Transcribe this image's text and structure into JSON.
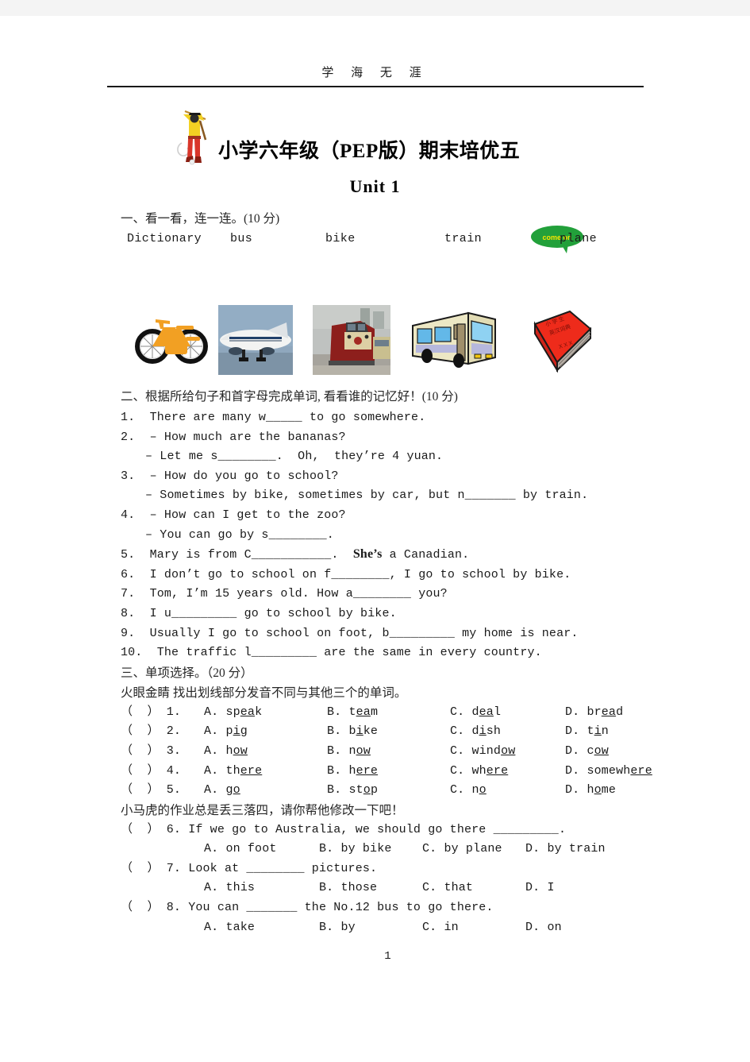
{
  "header": {
    "watermark": "学 海 无 涯"
  },
  "title": {
    "main": "小学六年级（PEP版）期末培优五",
    "main_prefix": "小学六年级（",
    "main_pep": "PEP",
    "main_suffix": "版）期末培优五",
    "badge": "come on",
    "badge_color": "#22a03a",
    "badge_text_color": "#f5e400",
    "unit": "Unit 1"
  },
  "section1": {
    "heading": "一、看一看，连一连。(10 分)",
    "words": [
      "Dictionary",
      "bus",
      "bike",
      "train",
      "plane"
    ],
    "pictures": [
      {
        "name": "bicycle-picture",
        "alt": "bike"
      },
      {
        "name": "airplane-picture",
        "alt": "plane"
      },
      {
        "name": "train-picture",
        "alt": "train"
      },
      {
        "name": "bus-picture",
        "alt": "bus"
      },
      {
        "name": "dictionary-picture",
        "alt": "Dictionary"
      }
    ]
  },
  "section2": {
    "heading": "二、根据所给句子和首字母完成单词, 看看谁的记忆好！(10 分)",
    "items": [
      {
        "no": "1.",
        "lines": [
          {
            "text": "1.  There are many w_____ to go somewhere.",
            "indent": false
          }
        ]
      },
      {
        "no": "2.",
        "lines": [
          {
            "text": "2.  – How much are the bananas?",
            "indent": false
          },
          {
            "text": "– Let me s________.  Oh,  they’re 4 yuan.",
            "indent": true
          }
        ]
      },
      {
        "no": "3.",
        "lines": [
          {
            "text": "3.  – How do you go to school?",
            "indent": false
          },
          {
            "text": "– Sometimes by bike, sometimes by car, but n_______ by train.",
            "indent": true
          }
        ]
      },
      {
        "no": "4.",
        "lines": [
          {
            "text": "4.  – How can I get to the zoo?",
            "indent": false
          },
          {
            "text": "– You can go by s________.",
            "indent": true
          }
        ]
      },
      {
        "no": "5.",
        "lines": [
          {
            "text": "5.  Mary is from C___________.  ",
            "indent": false,
            "tail": "She’s",
            "tail2": " a Canadian."
          }
        ]
      },
      {
        "no": "6.",
        "lines": [
          {
            "text": "6.  I don’t go to school on f________, I go to school by bike.",
            "indent": false
          }
        ]
      },
      {
        "no": "7.",
        "lines": [
          {
            "text": "7.  Tom, I’m 15 years old. How a________ you?",
            "indent": false
          }
        ]
      },
      {
        "no": "8.",
        "lines": [
          {
            "text": "8.  I u_________ go to school by bike.",
            "indent": false
          }
        ]
      },
      {
        "no": "9.",
        "lines": [
          {
            "text": "9.  Usually I go to school on foot, b_________ my home is near.",
            "indent": false
          }
        ]
      },
      {
        "no": "10.",
        "lines": [
          {
            "text": "10.  The traffic l_________ are the same in every country.",
            "indent": false
          }
        ]
      }
    ]
  },
  "section3": {
    "heading": "三、单项选择。（20 分）",
    "subheading_a": "火眼金睛  找出划线部分发音不同与其他三个的单词。",
    "pronunciation_items": [
      {
        "num": "1.",
        "options": [
          {
            "label": "A.",
            "pre": "sp",
            "u": "ea",
            "post": "k"
          },
          {
            "label": "B.",
            "pre": "t",
            "u": "ea",
            "post": "m"
          },
          {
            "label": "C.",
            "pre": "d",
            "u": "ea",
            "post": "l"
          },
          {
            "label": "D.",
            "pre": "br",
            "u": "ea",
            "post": "d"
          }
        ]
      },
      {
        "num": "2.",
        "options": [
          {
            "label": "A.",
            "pre": "p",
            "u": "i",
            "post": "g"
          },
          {
            "label": "B.",
            "pre": "b",
            "u": "i",
            "post": "ke"
          },
          {
            "label": "C.",
            "pre": "d",
            "u": "i",
            "post": "sh"
          },
          {
            "label": "D.",
            "pre": "t",
            "u": "i",
            "post": "n"
          }
        ]
      },
      {
        "num": "3.",
        "options": [
          {
            "label": "A.",
            "pre": "h",
            "u": "ow",
            "post": ""
          },
          {
            "label": "B.",
            "pre": "n",
            "u": "ow",
            "post": ""
          },
          {
            "label": "C.",
            "pre": "wind",
            "u": "ow",
            "post": ""
          },
          {
            "label": "D.",
            "pre": "c",
            "u": "ow",
            "post": ""
          }
        ]
      },
      {
        "num": "4.",
        "options": [
          {
            "label": "A.",
            "pre": "th",
            "u": "ere",
            "post": ""
          },
          {
            "label": "B.",
            "pre": "h",
            "u": "ere",
            "post": ""
          },
          {
            "label": "C.",
            "pre": "wh",
            "u": "ere",
            "post": ""
          },
          {
            "label": "D.",
            "pre": "somewh",
            "u": "ere",
            "post": ""
          }
        ]
      },
      {
        "num": "5.",
        "options": [
          {
            "label": "A.",
            "pre": "g",
            "u": "o",
            "post": ""
          },
          {
            "label": "B.",
            "pre": "st",
            "u": "o",
            "post": "p"
          },
          {
            "label": "C.",
            "pre": "n",
            "u": "o",
            "post": ""
          },
          {
            "label": "D.",
            "pre": "h",
            "u": "o",
            "post": "me"
          }
        ]
      }
    ],
    "subheading_b": "小马虎的作业总是丢三落四，请你帮他修改一下吧！",
    "choice_items": [
      {
        "num": "6.",
        "stem": "If we go to Australia, we should go there _________.",
        "options": [
          "A. on foot",
          "B. by bike",
          "C. by plane",
          "D. by train"
        ]
      },
      {
        "num": "7.",
        "stem": "Look at ________ pictures.",
        "options": [
          "A. this",
          "B. those",
          "C. that",
          "D. I"
        ]
      },
      {
        "num": "8.",
        "stem": "You can _______ the No.12 bus to go there.",
        "options": [
          "A. take",
          "B. by",
          "C. in",
          "D. on"
        ]
      }
    ],
    "bracket": "（  ）"
  },
  "footer": {
    "page_number": "1"
  }
}
